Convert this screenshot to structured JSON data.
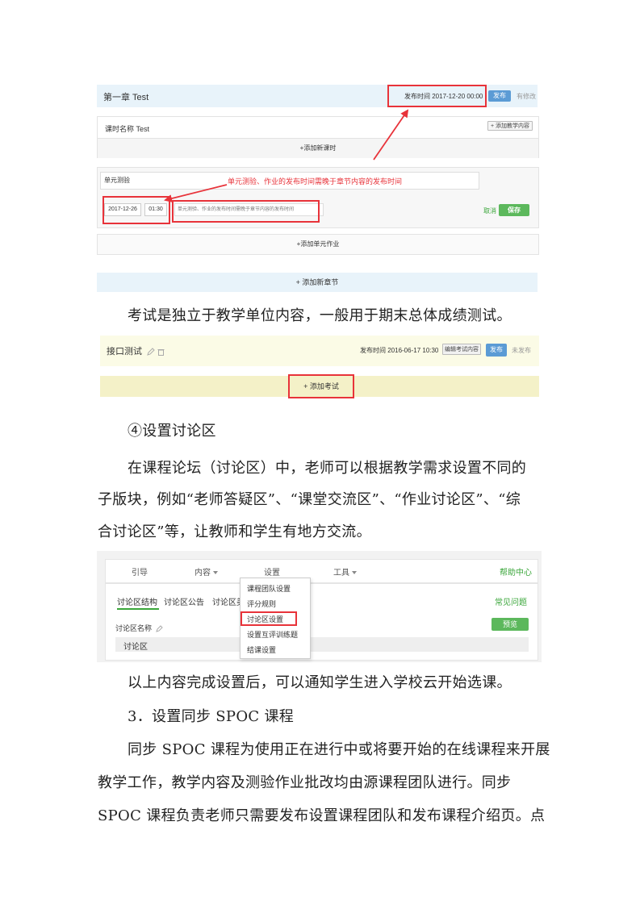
{
  "screenshot1": {
    "chapter_title": "第一章 Test",
    "publish_time_label": "发布时间 2017-12-20 00:00",
    "publish_button": "发布",
    "modified_label": "有修改",
    "lesson_name": "课时名称 Test",
    "add_content_button": "+ 添加教学内容",
    "add_lesson": "+添加新课时",
    "quiz_title": "单元测验",
    "annotation": "单元测验、作业的发布时间需晚于章节内容的发布时间",
    "date_value": "2017-12-26",
    "time_value": "01:30",
    "desc_value": "单元测验、作业的发布时间需晚于章节内容的发布时间",
    "cancel": "取消",
    "save": "保存",
    "add_homework": "+添加单元作业",
    "add_chapter": "+ 添加新章节"
  },
  "para1": "考试是独立于教学单位内容，一般用于期末总体成绩测试。",
  "screenshot2": {
    "exam_title": "接口测试",
    "publish_time": "发布时间 2016-06-17 10:30",
    "edit_settings": "编辑考试内容",
    "publish": "发布",
    "unpublished": "未发布",
    "add_exam": "+ 添加考试"
  },
  "heading4": "④设置讨论区",
  "para2_line1": "在课程论坛（讨论区）中，老师可以根据教学需求设置不同的",
  "para2_line2": "子版块，例如“老师答疑区”、“课堂交流区”、“作业讨论区”、“综",
  "para2_line3": "合讨论区”等，让教师和学生有地方交流。",
  "screenshot3": {
    "nav": [
      "引导",
      "内容",
      "设置",
      "工具"
    ],
    "help": "帮助中心",
    "tabs": [
      "讨论区结构",
      "讨论区公告",
      "讨论区美"
    ],
    "faq": "常见问题",
    "name_label": "讨论区名称",
    "preview": "预览",
    "forum": "讨论区",
    "dropdown": [
      "课程团队设置",
      "评分规则",
      "讨论区设置",
      "设置互评训练题",
      "结课设置"
    ]
  },
  "para3": "以上内容完成设置后，可以通知学生进入学校云开始选课。",
  "heading3": "3．设置同步 SPOC 课程",
  "para4_line1": "同步 SPOC 课程为使用正在进行中或将要开始的在线课程来开展",
  "para4_line2": "教学工作，教学内容及测验作业批改均由源课程团队进行。同步",
  "para4_line3": "SPOC 课程负责老师只需要发布设置课程团队和发布课程介绍页。点",
  "colors": {
    "accent_red": "#e8333a",
    "green": "#5cb85c",
    "blue": "#5b9bd5"
  }
}
